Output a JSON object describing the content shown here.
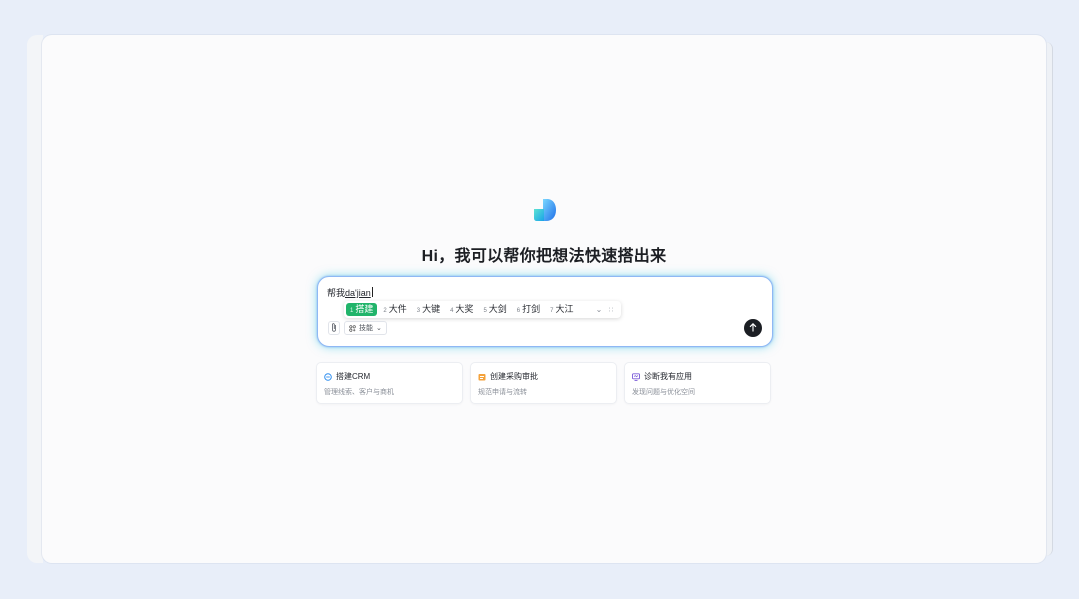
{
  "headline": "Hi，我可以帮你把想法快速搭出来",
  "composer": {
    "prefix": "帮我",
    "pinyin": "da'jian",
    "ime_candidates": [
      {
        "num": "1",
        "text": "搭建"
      },
      {
        "num": "2",
        "text": "大件"
      },
      {
        "num": "3",
        "text": "大键"
      },
      {
        "num": "4",
        "text": "大奖"
      },
      {
        "num": "5",
        "text": "大剑"
      },
      {
        "num": "6",
        "text": "打剑"
      },
      {
        "num": "7",
        "text": "大江"
      }
    ],
    "attach_icon": "paperclip-icon",
    "mode_label": "技能",
    "send_icon": "arrow-up-icon"
  },
  "cards": [
    {
      "title": "搭建CRM",
      "subtitle": "管理线索、客户与商机",
      "icon": "crm-icon"
    },
    {
      "title": "创建采购审批",
      "subtitle": "规范申请与流转",
      "icon": "approval-icon"
    },
    {
      "title": "诊断我有应用",
      "subtitle": "发现问题与优化空间",
      "icon": "monitor-icon"
    }
  ],
  "colors": {
    "active_candidate": "#21b46a",
    "send_button": "#1b1e23",
    "glow": "#3cc8e6"
  }
}
